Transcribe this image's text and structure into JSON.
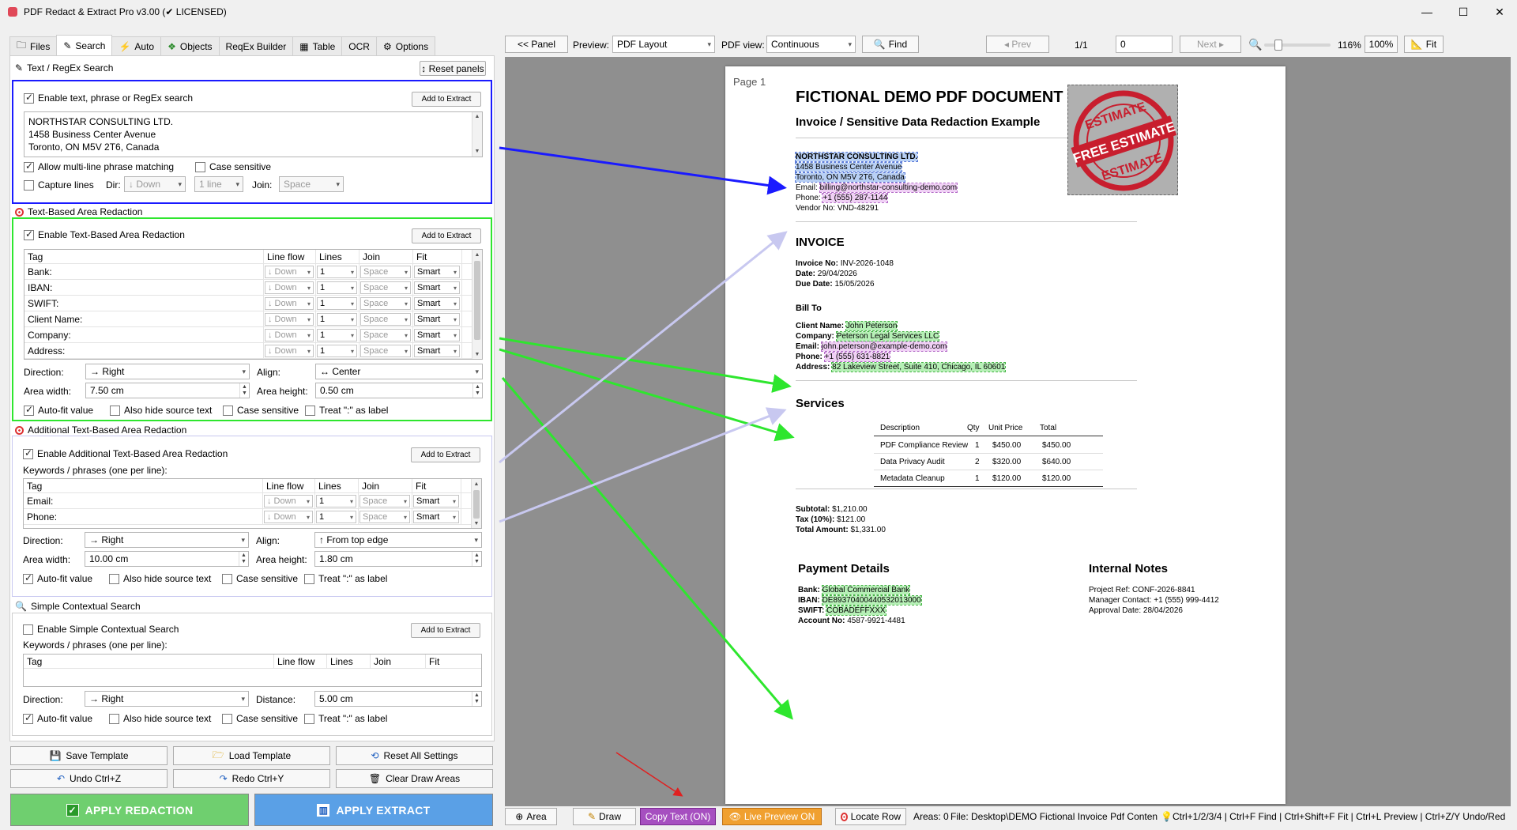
{
  "window": {
    "title": "PDF Redact & Extract Pro v3.00 (✔ LICENSED)"
  },
  "tabs": [
    {
      "label": "Files",
      "icon": "folder-icon"
    },
    {
      "label": "Search",
      "icon": "pencil-icon"
    },
    {
      "label": "Auto",
      "icon": "lightning-icon"
    },
    {
      "label": "Objects",
      "icon": "objects-icon"
    },
    {
      "label": "ReqEx Builder",
      "icon": ""
    },
    {
      "label": "Table",
      "icon": "table-icon"
    },
    {
      "label": "OCR",
      "icon": ""
    },
    {
      "label": "Options",
      "icon": "gear-icon"
    }
  ],
  "text_search": {
    "title": "Text / RegEx Search",
    "reset_panels": "Reset panels",
    "enable_label": "Enable text, phrase or RegEx search",
    "add_to_extract": "Add to Extract",
    "query_lines": [
      "NORTHSTAR CONSULTING LTD.",
      "1458 Business Center Avenue",
      "Toronto, ON M5V 2T6, Canada"
    ],
    "multiline_label": "Allow multi-line phrase matching",
    "case_sensitive_label": "Case sensitive",
    "capture_lines_label": "Capture lines",
    "dir_label": "Dir:",
    "dir_value": "↓ Down",
    "lines_value": "1 line",
    "join_label": "Join:",
    "join_value": "Space"
  },
  "area_redaction": {
    "title": "Text-Based Area Redaction",
    "enable_label": "Enable Text-Based Area Redaction",
    "add_to_extract": "Add to Extract",
    "columns": [
      "Tag",
      "Line flow",
      "Lines",
      "Join",
      "Fit"
    ],
    "rows": [
      {
        "tag": "Bank:",
        "flow": "↓ Down",
        "lines": "1",
        "join": "Space",
        "fit": "Smart"
      },
      {
        "tag": "IBAN:",
        "flow": "↓ Down",
        "lines": "1",
        "join": "Space",
        "fit": "Smart"
      },
      {
        "tag": "SWIFT:",
        "flow": "↓ Down",
        "lines": "1",
        "join": "Space",
        "fit": "Smart"
      },
      {
        "tag": "Client Name:",
        "flow": "↓ Down",
        "lines": "1",
        "join": "Space",
        "fit": "Smart"
      },
      {
        "tag": "Company:",
        "flow": "↓ Down",
        "lines": "1",
        "join": "Space",
        "fit": "Smart"
      },
      {
        "tag": "Address:",
        "flow": "↓ Down",
        "lines": "1",
        "join": "Space",
        "fit": "Smart"
      }
    ],
    "direction_label": "Direction:",
    "direction_value": "→ Right",
    "align_label": "Align:",
    "align_value": "↔ Center",
    "width_label": "Area width:",
    "width_value": "7.50 cm",
    "height_label": "Area height:",
    "height_value": "0.50 cm",
    "autofit_label": "Auto-fit value",
    "hide_source_label": "Also hide source text",
    "case_label": "Case sensitive",
    "treat_label": "Treat \":\" as label"
  },
  "additional_redaction": {
    "title": "Additional Text-Based Area Redaction",
    "enable_label": "Enable Additional Text-Based Area Redaction",
    "add_to_extract": "Add to Extract",
    "keywords_label": "Keywords / phrases (one per line):",
    "columns": [
      "Tag",
      "Line flow",
      "Lines",
      "Join",
      "Fit"
    ],
    "rows": [
      {
        "tag": "Email:",
        "flow": "↓ Down",
        "lines": "1",
        "join": "Space",
        "fit": "Smart"
      },
      {
        "tag": "Phone:",
        "flow": "↓ Down",
        "lines": "1",
        "join": "Space",
        "fit": "Smart"
      }
    ],
    "direction_label": "Direction:",
    "direction_value": "→ Right",
    "align_label": "Align:",
    "align_value": "↑ From top edge",
    "width_label": "Area width:",
    "width_value": "10.00 cm",
    "height_label": "Area height:",
    "height_value": "1.80 cm",
    "autofit_label": "Auto-fit value",
    "hide_source_label": "Also hide source text",
    "case_label": "Case sensitive",
    "treat_label": "Treat \":\" as label"
  },
  "contextual_search": {
    "title": "Simple Contextual Search",
    "enable_label": "Enable Simple Contextual Search",
    "add_to_extract": "Add to Extract",
    "keywords_label": "Keywords / phrases (one per line):",
    "columns": [
      "Tag",
      "Line flow",
      "Lines",
      "Join",
      "Fit"
    ],
    "direction_label": "Direction:",
    "direction_value": "→ Right",
    "distance_label": "Distance:",
    "distance_value": "5.00 cm",
    "autofit_label": "Auto-fit value",
    "hide_source_label": "Also hide source text",
    "case_label": "Case sensitive",
    "treat_label": "Treat \":\" as label"
  },
  "actions": {
    "save_template": "Save Template",
    "load_template": "Load Template",
    "reset_all": "Reset All Settings",
    "undo": "Undo  Ctrl+Z",
    "redo": "Redo  Ctrl+Y",
    "clear_draw": "Clear Draw Areas",
    "apply_redaction": "APPLY REDACTION",
    "apply_extract": "APPLY EXTRACT"
  },
  "toolbar": {
    "panel": "<< Panel",
    "preview_label": "Preview:",
    "preview_value": "PDF Layout",
    "pdfview_label": "PDF view:",
    "pdfview_value": "Continuous",
    "find": "Find",
    "prev": "◂ Prev",
    "page_count": "1/1",
    "page_input": "0",
    "next": "Next ▸",
    "zoom_percent": "116%",
    "zoom_100": "100%",
    "fit": "Fit",
    "zoom_slider_fraction": 0.15
  },
  "document": {
    "page_label": "Page 1",
    "title": "FICTIONAL DEMO PDF DOCUMENT",
    "subtitle": "Invoice / Sensitive Data Redaction Example",
    "vendor_name": "NORTHSTAR CONSULTING LTD.",
    "vendor_street": "1458 Business Center Avenue",
    "vendor_city": "Toronto, ON M5V 2T6, Canada",
    "vendor_email_label": "Email:",
    "vendor_email": "billing@northstar-consulting-demo.com",
    "vendor_phone_label": "Phone:",
    "vendor_phone": "+1 (555) 287-1144",
    "vendor_no": "Vendor No: VND-48291",
    "stamp_text_top": "ESTIMATE",
    "stamp_text_mid": "FREE ESTIMATE",
    "stamp_text_bot": "ESTIMATE",
    "invoice_heading": "INVOICE",
    "invoice_no_label": "Invoice No:",
    "invoice_no": "INV-2026-1048",
    "date_label": "Date:",
    "date": "29/04/2026",
    "due_label": "Due Date:",
    "due": "15/05/2026",
    "bill_to": "Bill To",
    "client_label": "Client Name:",
    "client": "John Peterson",
    "company_label": "Company:",
    "company": "Peterson Legal Services LLC",
    "email_label": "Email:",
    "email": "john.peterson@example-demo.com",
    "phone_label": "Phone:",
    "phone": "+1 (555) 631-8821",
    "address_label": "Address:",
    "address": "82 Lakeview Street, Suite 410, Chicago, IL 60601",
    "services_heading": "Services",
    "services_columns": [
      "Description",
      "Qty",
      "Unit Price",
      "Total"
    ],
    "services_rows": [
      [
        "PDF Compliance Review",
        "1",
        "$450.00",
        "$450.00"
      ],
      [
        "Data Privacy Audit",
        "2",
        "$320.00",
        "$640.00"
      ],
      [
        "Metadata Cleanup",
        "1",
        "$120.00",
        "$120.00"
      ]
    ],
    "subtotal_label": "Subtotal:",
    "subtotal": "$1,210.00",
    "tax_label": "Tax (10%):",
    "tax": "$121.00",
    "total_label": "Total Amount:",
    "total": "$1,331.00",
    "payment_heading": "Payment Details",
    "bank_label": "Bank:",
    "bank": "Global Commercial Bank",
    "iban_label": "IBAN:",
    "iban": "DE89370400440532013000",
    "swift_label": "SWIFT:",
    "swift": "COBADEFFXXX",
    "account_label": "Account No:",
    "account": "4587-9921-4481",
    "notes_heading": "Internal Notes",
    "project_ref": "Project Ref: CONF-2026-8841",
    "manager_contact": "Manager Contact: +1 (555) 999-4412",
    "approval_date": "Approval Date: 28/04/2026"
  },
  "statusbar": {
    "area": "Area",
    "draw": "Draw",
    "copy_text": "Copy Text (ON)",
    "live_preview": "Live Preview ON",
    "locate_row": "Locate Row",
    "areas_count": "Areas: 0",
    "file_info": "File: Desktop\\DEMO Fictional Invoice Pdf Content",
    "shortcuts": "Ctrl+1/2/3/4 | Ctrl+F Find | Ctrl+Shift+F Fit | Ctrl+L Preview | Ctrl+Z/Y Undo/Red"
  },
  "colors": {
    "text_search_border": "#1a1aff",
    "area_border": "#2ee62e",
    "additional_border": "#c8c8f0",
    "apply_redaction_bg": "#6fcf6f",
    "apply_extract_bg": "#5aa0e6",
    "copy_text_bg": "#a64fc0",
    "live_preview_bg": "#f0a030",
    "highlight_blue": "#b8d0f5",
    "highlight_green": "#b6f0b6",
    "highlight_pink": "#f0d0f5"
  }
}
